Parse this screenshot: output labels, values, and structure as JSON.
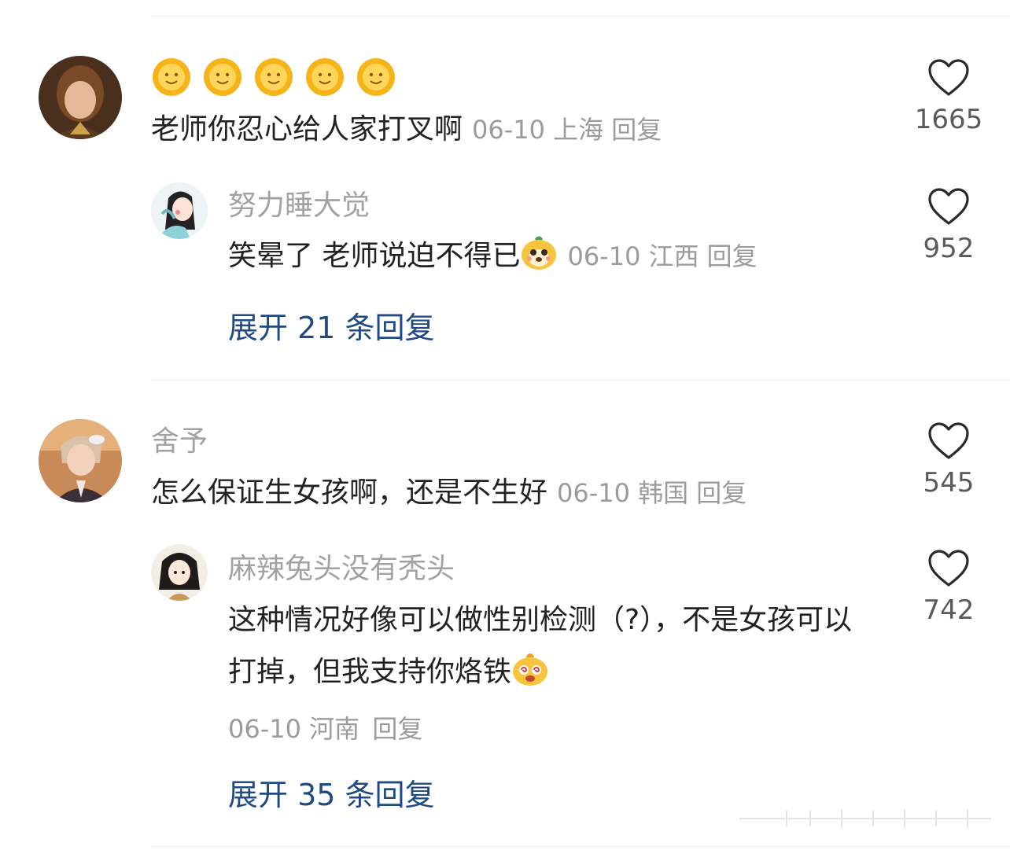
{
  "comments": [
    {
      "text": "老师你忍心给人家打叉啊",
      "date": "06-10",
      "location": "上海",
      "reply_label": "回复",
      "likes": "1665",
      "emojis": [
        "sun-face",
        "sun-face",
        "sun-face",
        "sun-face",
        "sun-face"
      ],
      "reply": {
        "username": "努力睡大觉",
        "text": "笑晕了 老师说迫不得已",
        "emoji": "dog-face",
        "date": "06-10",
        "location": "江西",
        "reply_label": "回复",
        "likes": "952"
      },
      "expand_label": "展开 21 条回复"
    },
    {
      "username": "舍予",
      "text": "怎么保证生女孩啊，还是不生好",
      "date": "06-10",
      "location": "韩国",
      "reply_label": "回复",
      "likes": "545",
      "reply": {
        "username": "麻辣兔头没有秃头",
        "text": "这种情况好像可以做性别检测（?），不是女孩可以打掉，但我支持你烙铁",
        "emoji": "dizzy-face",
        "date": "06-10",
        "location": "河南",
        "reply_label": "回复",
        "likes": "742"
      },
      "expand_label": "展开 35 条回复"
    }
  ],
  "colors": {
    "link": "#1f4a82",
    "meta": "#9b9b9b",
    "username": "#a2a2a2",
    "text": "#222222"
  }
}
